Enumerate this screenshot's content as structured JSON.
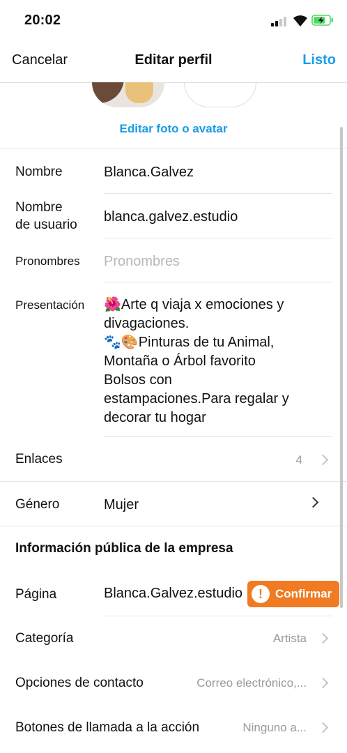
{
  "status": {
    "time": "20:02"
  },
  "nav": {
    "cancel": "Cancelar",
    "title": "Editar perfil",
    "done": "Listo"
  },
  "photo": {
    "edit_label": "Editar foto o avatar"
  },
  "fields": {
    "name": {
      "label": "Nombre",
      "value": "Blanca.Galvez"
    },
    "username": {
      "label_line1": "Nombre",
      "label_line2": "de usuario",
      "value": "blanca.galvez.estudio"
    },
    "pronouns": {
      "label": "Pronombres",
      "placeholder": "Pronombres"
    },
    "bio": {
      "label": "Presentación",
      "lines": [
        "🌺Arte q viaja x emociones y",
        "divagaciones.",
        "🐾🎨Pinturas de tu Animal,",
        "Montaña o Árbol favorito",
        "Bolsos con",
        "estampaciones.Para regalar y",
        "decorar tu hogar"
      ]
    },
    "links": {
      "label": "Enlaces",
      "value": "4"
    },
    "gender": {
      "label": "Género",
      "value": "Mujer"
    }
  },
  "business": {
    "title": "Información pública de la empresa",
    "page": {
      "label": "Página",
      "value": "Blanca.Galvez.estudio",
      "confirm": "Confirmar"
    },
    "category": {
      "label": "Categoría",
      "value": "Artista"
    },
    "contact": {
      "label": "Opciones de contacto",
      "value": "Correo electrónico,..."
    },
    "cta": {
      "label": "Botones de llamada a la acción",
      "value": "Ninguno a..."
    }
  },
  "colors": {
    "accent": "#1a9de8",
    "confirm": "#f07b22"
  }
}
